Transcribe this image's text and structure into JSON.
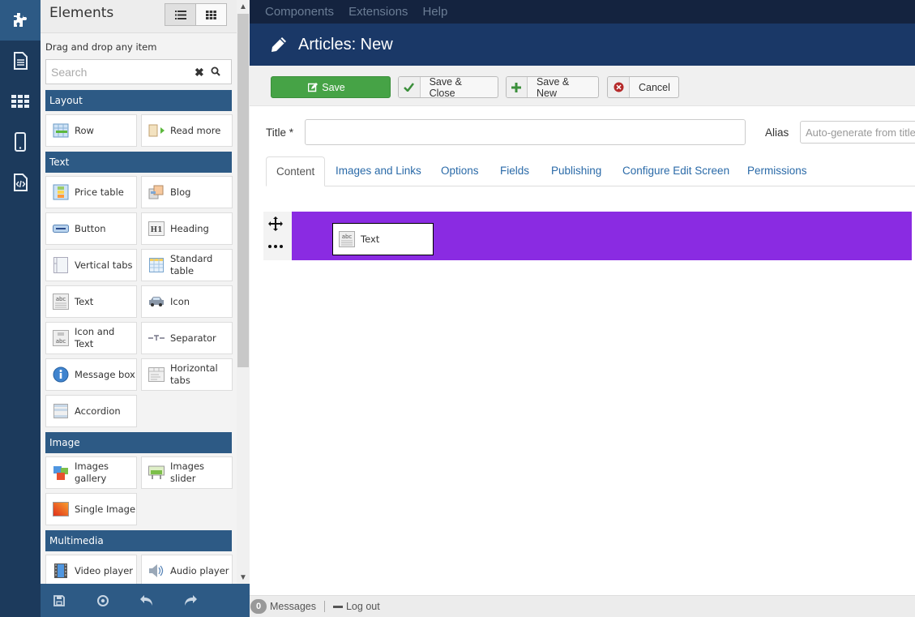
{
  "rail": {
    "items": [
      {
        "icon": "puzzle-icon",
        "active": true
      },
      {
        "icon": "document-icon",
        "active": false
      },
      {
        "icon": "grid-icon",
        "active": false
      },
      {
        "icon": "mobile-icon",
        "active": false
      },
      {
        "icon": "code-file-icon",
        "active": false
      }
    ]
  },
  "panel": {
    "title": "Elements",
    "hint": "Drag and drop any item",
    "search": {
      "placeholder": "Search",
      "value": ""
    },
    "view_modes": [
      "list",
      "grid"
    ],
    "categories": [
      {
        "label": "Layout",
        "items": [
          {
            "label": "Row",
            "icon": "row-icon"
          },
          {
            "label": "Read more",
            "icon": "read-more-icon"
          }
        ]
      },
      {
        "label": "Text",
        "items": [
          {
            "label": "Price table",
            "icon": "price-table-icon"
          },
          {
            "label": "Blog",
            "icon": "blog-icon"
          },
          {
            "label": "Button",
            "icon": "button-icon"
          },
          {
            "label": "Heading",
            "icon": "heading-icon"
          },
          {
            "label": "Vertical tabs",
            "icon": "vertical-tabs-icon"
          },
          {
            "label": "Standard table",
            "icon": "table-icon"
          },
          {
            "label": "Text",
            "icon": "text-icon"
          },
          {
            "label": "Icon",
            "icon": "car-icon"
          },
          {
            "label": "Icon and Text",
            "icon": "icon-text-icon"
          },
          {
            "label": "Separator",
            "icon": "separator-icon"
          },
          {
            "label": "Message box",
            "icon": "info-icon"
          },
          {
            "label": "Horizontal tabs",
            "icon": "horizontal-tabs-icon"
          },
          {
            "label": "Accordion",
            "icon": "accordion-icon"
          }
        ]
      },
      {
        "label": "Image",
        "items": [
          {
            "label": "Images gallery",
            "icon": "gallery-icon"
          },
          {
            "label": "Images slider",
            "icon": "slider-icon"
          },
          {
            "label": "Single Image",
            "icon": "image-icon"
          }
        ]
      },
      {
        "label": "Multimedia",
        "items": [
          {
            "label": "Video player",
            "icon": "video-icon"
          },
          {
            "label": "Audio player",
            "icon": "audio-icon"
          }
        ]
      }
    ]
  },
  "bottom_bar": {
    "buttons": [
      "save-icon",
      "preview-icon",
      "undo-icon",
      "redo-icon"
    ]
  },
  "topmenu": {
    "items": [
      "Components",
      "Extensions",
      "Help"
    ]
  },
  "header": {
    "title": "Articles: New",
    "icon": "pencil-icon"
  },
  "toolbar": {
    "save": "Save",
    "save_close": "Save & Close",
    "save_new": "Save & New",
    "cancel": "Cancel"
  },
  "form": {
    "title_label": "Title *",
    "title_value": "",
    "alias_label": "Alias",
    "alias_placeholder": "Auto-generate from title",
    "tabs": [
      "Content",
      "Images and Links",
      "Options",
      "Fields",
      "Publishing",
      "Configure Edit Screen",
      "Permissions"
    ],
    "active_tab": "Content"
  },
  "builder": {
    "row_color": "#8a2be2",
    "blocks": [
      {
        "label": "Text",
        "icon": "text-icon"
      }
    ]
  },
  "statusbar": {
    "messages_count": "0",
    "messages_label": "Messages",
    "logout_label": "Log out"
  }
}
